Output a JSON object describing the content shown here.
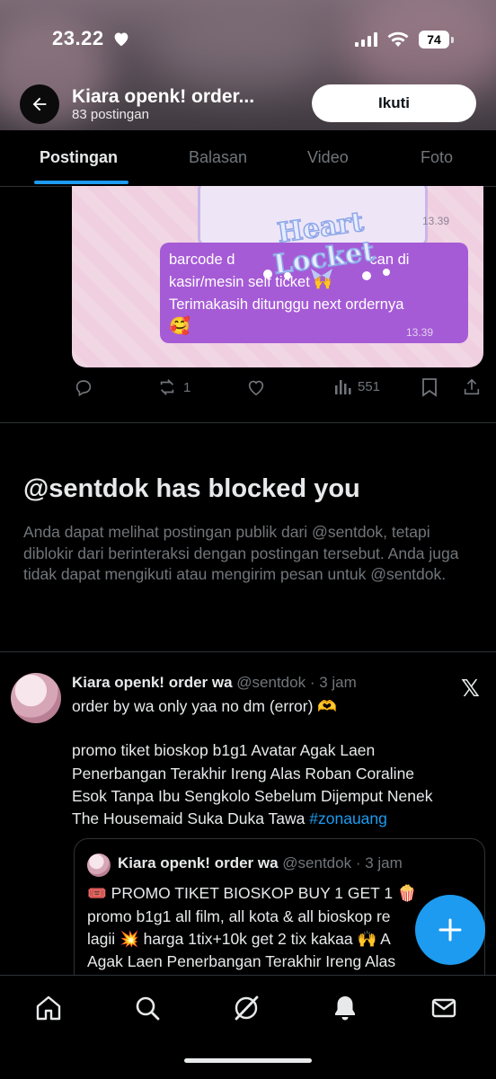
{
  "status_bar": {
    "time": "23.22",
    "battery": "74"
  },
  "header": {
    "profile_name": "Kiara openk! order...",
    "post_count": "83 postingan",
    "follow_label": "Ikuti"
  },
  "tabs": [
    "Postingan",
    "Balasan",
    "Video",
    "Foto"
  ],
  "media": {
    "card_time": "13.39",
    "bubble_lines": [
      "barcode d",
      "can di",
      "kasir/mesin self ticket 🙌",
      "Terimakasih ditunggu next ordernya"
    ],
    "bubble_emoji": "🥰",
    "bubble_time": "13.39",
    "sticker_text": "Heart Locket"
  },
  "actions": {
    "reposts": "1",
    "views": "551"
  },
  "blocked": {
    "title": "@sentdok has blocked you",
    "description": "Anda dapat melihat postingan publik dari @sentdok, tetapi diblokir dari berinteraksi dengan postingan tersebut. Anda juga tidak dapat mengikuti atau mengirim pesan untuk @sentdok."
  },
  "tweet": {
    "name": "Kiara openk! order wa",
    "handle": "@sentdok",
    "time": "· 3 jam",
    "line1": "order by wa only yaa no dm (error) 🫶",
    "line2": "promo tiket bioskop b1g1 Avatar Agak Laen",
    "line3": "Penerbangan Terakhir Ireng Alas Roban Coraline",
    "line4": "Esok Tanpa Ibu Sengkolo Sebelum Dijemput Nenek",
    "line5": "The Housemaid Suka Duka Tawa ",
    "hashtag": "#zonauang"
  },
  "quote": {
    "name": "Kiara openk! order wa",
    "handle": "@sentdok",
    "time": "· 3 jam",
    "line1": "🎟️ PROMO TIKET BIOSKOP BUY 1 GET 1 🍿",
    "line2": "promo b1g1 all film, all kota & all bioskop re",
    "line3": "lagii 💥 harga 1tix+10k get 2 tix kakaa 🙌 A",
    "line4": "Agak Laen Penerbangan Terakhir Ireng Alas"
  },
  "colors": {
    "accent": "#1d9bf0",
    "bubble": "#a65bd6",
    "muted": "#71767b"
  },
  "icons": [
    "heart-icon",
    "signal-icon",
    "wifi-icon",
    "back-arrow-icon",
    "reply-icon",
    "repost-icon",
    "like-icon",
    "views-icon",
    "bookmark-icon",
    "share-icon",
    "x-logo-icon",
    "plus-icon",
    "home-icon",
    "search-icon",
    "grok-icon",
    "notifications-icon",
    "messages-icon"
  ]
}
